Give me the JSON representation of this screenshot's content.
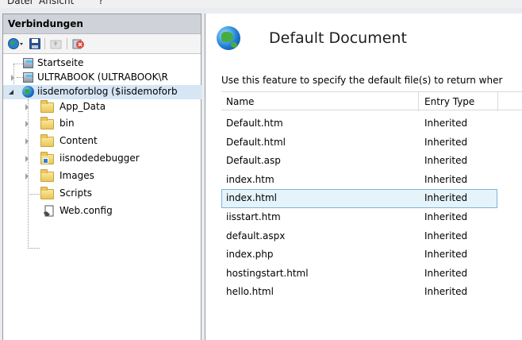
{
  "menu": {
    "items": [
      "Datei",
      "Ansicht",
      "?"
    ]
  },
  "connections": {
    "header": "Verbindungen",
    "tree": [
      {
        "label": "Startseite"
      },
      {
        "label": "ULTRABOOK (ULTRABOOK\\R"
      },
      {
        "label": "iisdemoforblog ($iisdemoforb"
      },
      {
        "label": "App_Data"
      },
      {
        "label": "bin"
      },
      {
        "label": "Content"
      },
      {
        "label": "iisnodedebugger"
      },
      {
        "label": "Images"
      },
      {
        "label": "Scripts"
      },
      {
        "label": "Web.config"
      }
    ]
  },
  "feature": {
    "title": "Default Document",
    "description": "Use this feature to specify the default file(s) to return wher",
    "columns": {
      "name": "Name",
      "entry_type": "Entry Type"
    },
    "rows": [
      {
        "name": "Default.htm",
        "type": "Inherited"
      },
      {
        "name": "Default.html",
        "type": "Inherited"
      },
      {
        "name": "Default.asp",
        "type": "Inherited"
      },
      {
        "name": "index.htm",
        "type": "Inherited"
      },
      {
        "name": "index.html",
        "type": "Inherited"
      },
      {
        "name": "iisstart.htm",
        "type": "Inherited"
      },
      {
        "name": "default.aspx",
        "type": "Inherited"
      },
      {
        "name": "index.php",
        "type": "Inherited"
      },
      {
        "name": "hostingstart.html",
        "type": "Inherited"
      },
      {
        "name": "hello.html",
        "type": "Inherited"
      }
    ],
    "selected_row": "index.html"
  },
  "colors": {
    "selection_bg": "#e5f3fb",
    "selection_border": "#7fb5d9",
    "panel_header": "#cfd3d9"
  }
}
